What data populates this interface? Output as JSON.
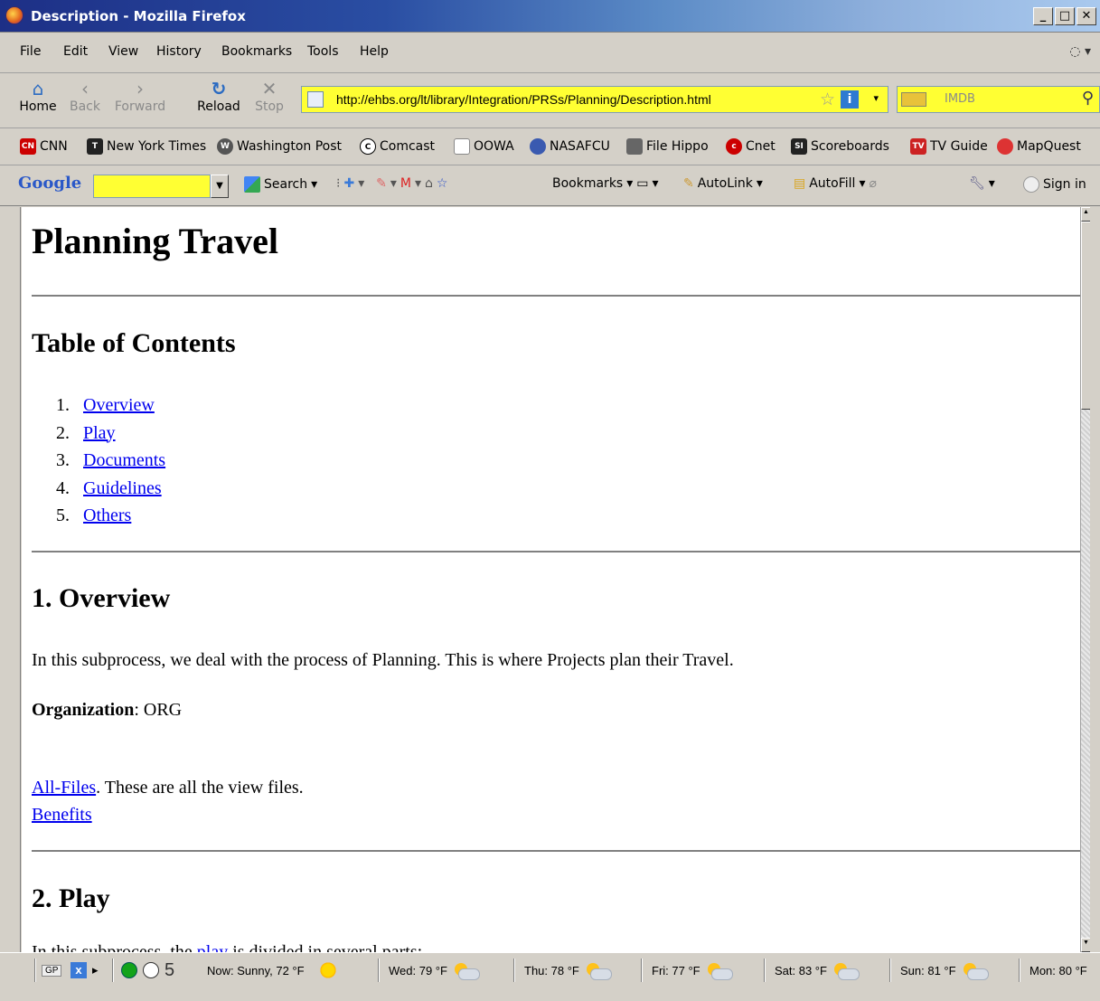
{
  "window": {
    "title": "Description - Mozilla Firefox"
  },
  "menu": [
    "File",
    "Edit",
    "View",
    "History",
    "Bookmarks",
    "Tools",
    "Help"
  ],
  "nav": {
    "home": "Home",
    "back": "Back",
    "forward": "Forward",
    "reload": "Reload",
    "stop": "Stop"
  },
  "url": "http://ehbs.org/lt/library/Integration/PRSs/Planning/Description.html",
  "search": {
    "placeholder": "IMDB"
  },
  "bookmarks": [
    "CNN",
    "New York Times",
    "Washington Post",
    "Comcast",
    "OOWA",
    "NASAFCU",
    "File Hippo",
    "Cnet",
    "Scoreboards",
    "TV Guide",
    "MapQuest"
  ],
  "google": {
    "logo": "Google",
    "search": "Search",
    "bookmarks": "Bookmarks",
    "autolink": "AutoLink",
    "autofill": "AutoFill",
    "signin": "Sign in"
  },
  "page": {
    "title": "Planning Travel",
    "toc_heading": "Table of Contents",
    "toc": [
      {
        "n": "1.",
        "label": "Overview"
      },
      {
        "n": "2.",
        "label": "Play"
      },
      {
        "n": "3.",
        "label": "Documents"
      },
      {
        "n": "4.",
        "label": "Guidelines"
      },
      {
        "n": "5.",
        "label": "Others"
      }
    ],
    "overview_heading": "1. Overview",
    "overview_text": "In this subprocess, we deal with the process of Planning. This is where Projects plan their Travel.",
    "org_label": "Organization",
    "org_value": ": ORG",
    "allfiles_link": "All-Files",
    "allfiles_text": ". These are all the view files.",
    "benefits_link": "Benefits",
    "play_heading": "2. Play",
    "play_text_pre": "In this subprocess, the ",
    "play_link": "play",
    "play_text_post": " is divided in several parts:"
  },
  "status": {
    "gp": "GP",
    "count": "5",
    "now": "Now: Sunny, 72 °F",
    "forecast": [
      {
        "day": "Wed: 79 °F"
      },
      {
        "day": "Thu: 78 °F"
      },
      {
        "day": "Fri: 77 °F"
      },
      {
        "day": "Sat: 83 °F"
      },
      {
        "day": "Sun: 81 °F"
      },
      {
        "day": "Mon: 80 °F"
      }
    ]
  }
}
